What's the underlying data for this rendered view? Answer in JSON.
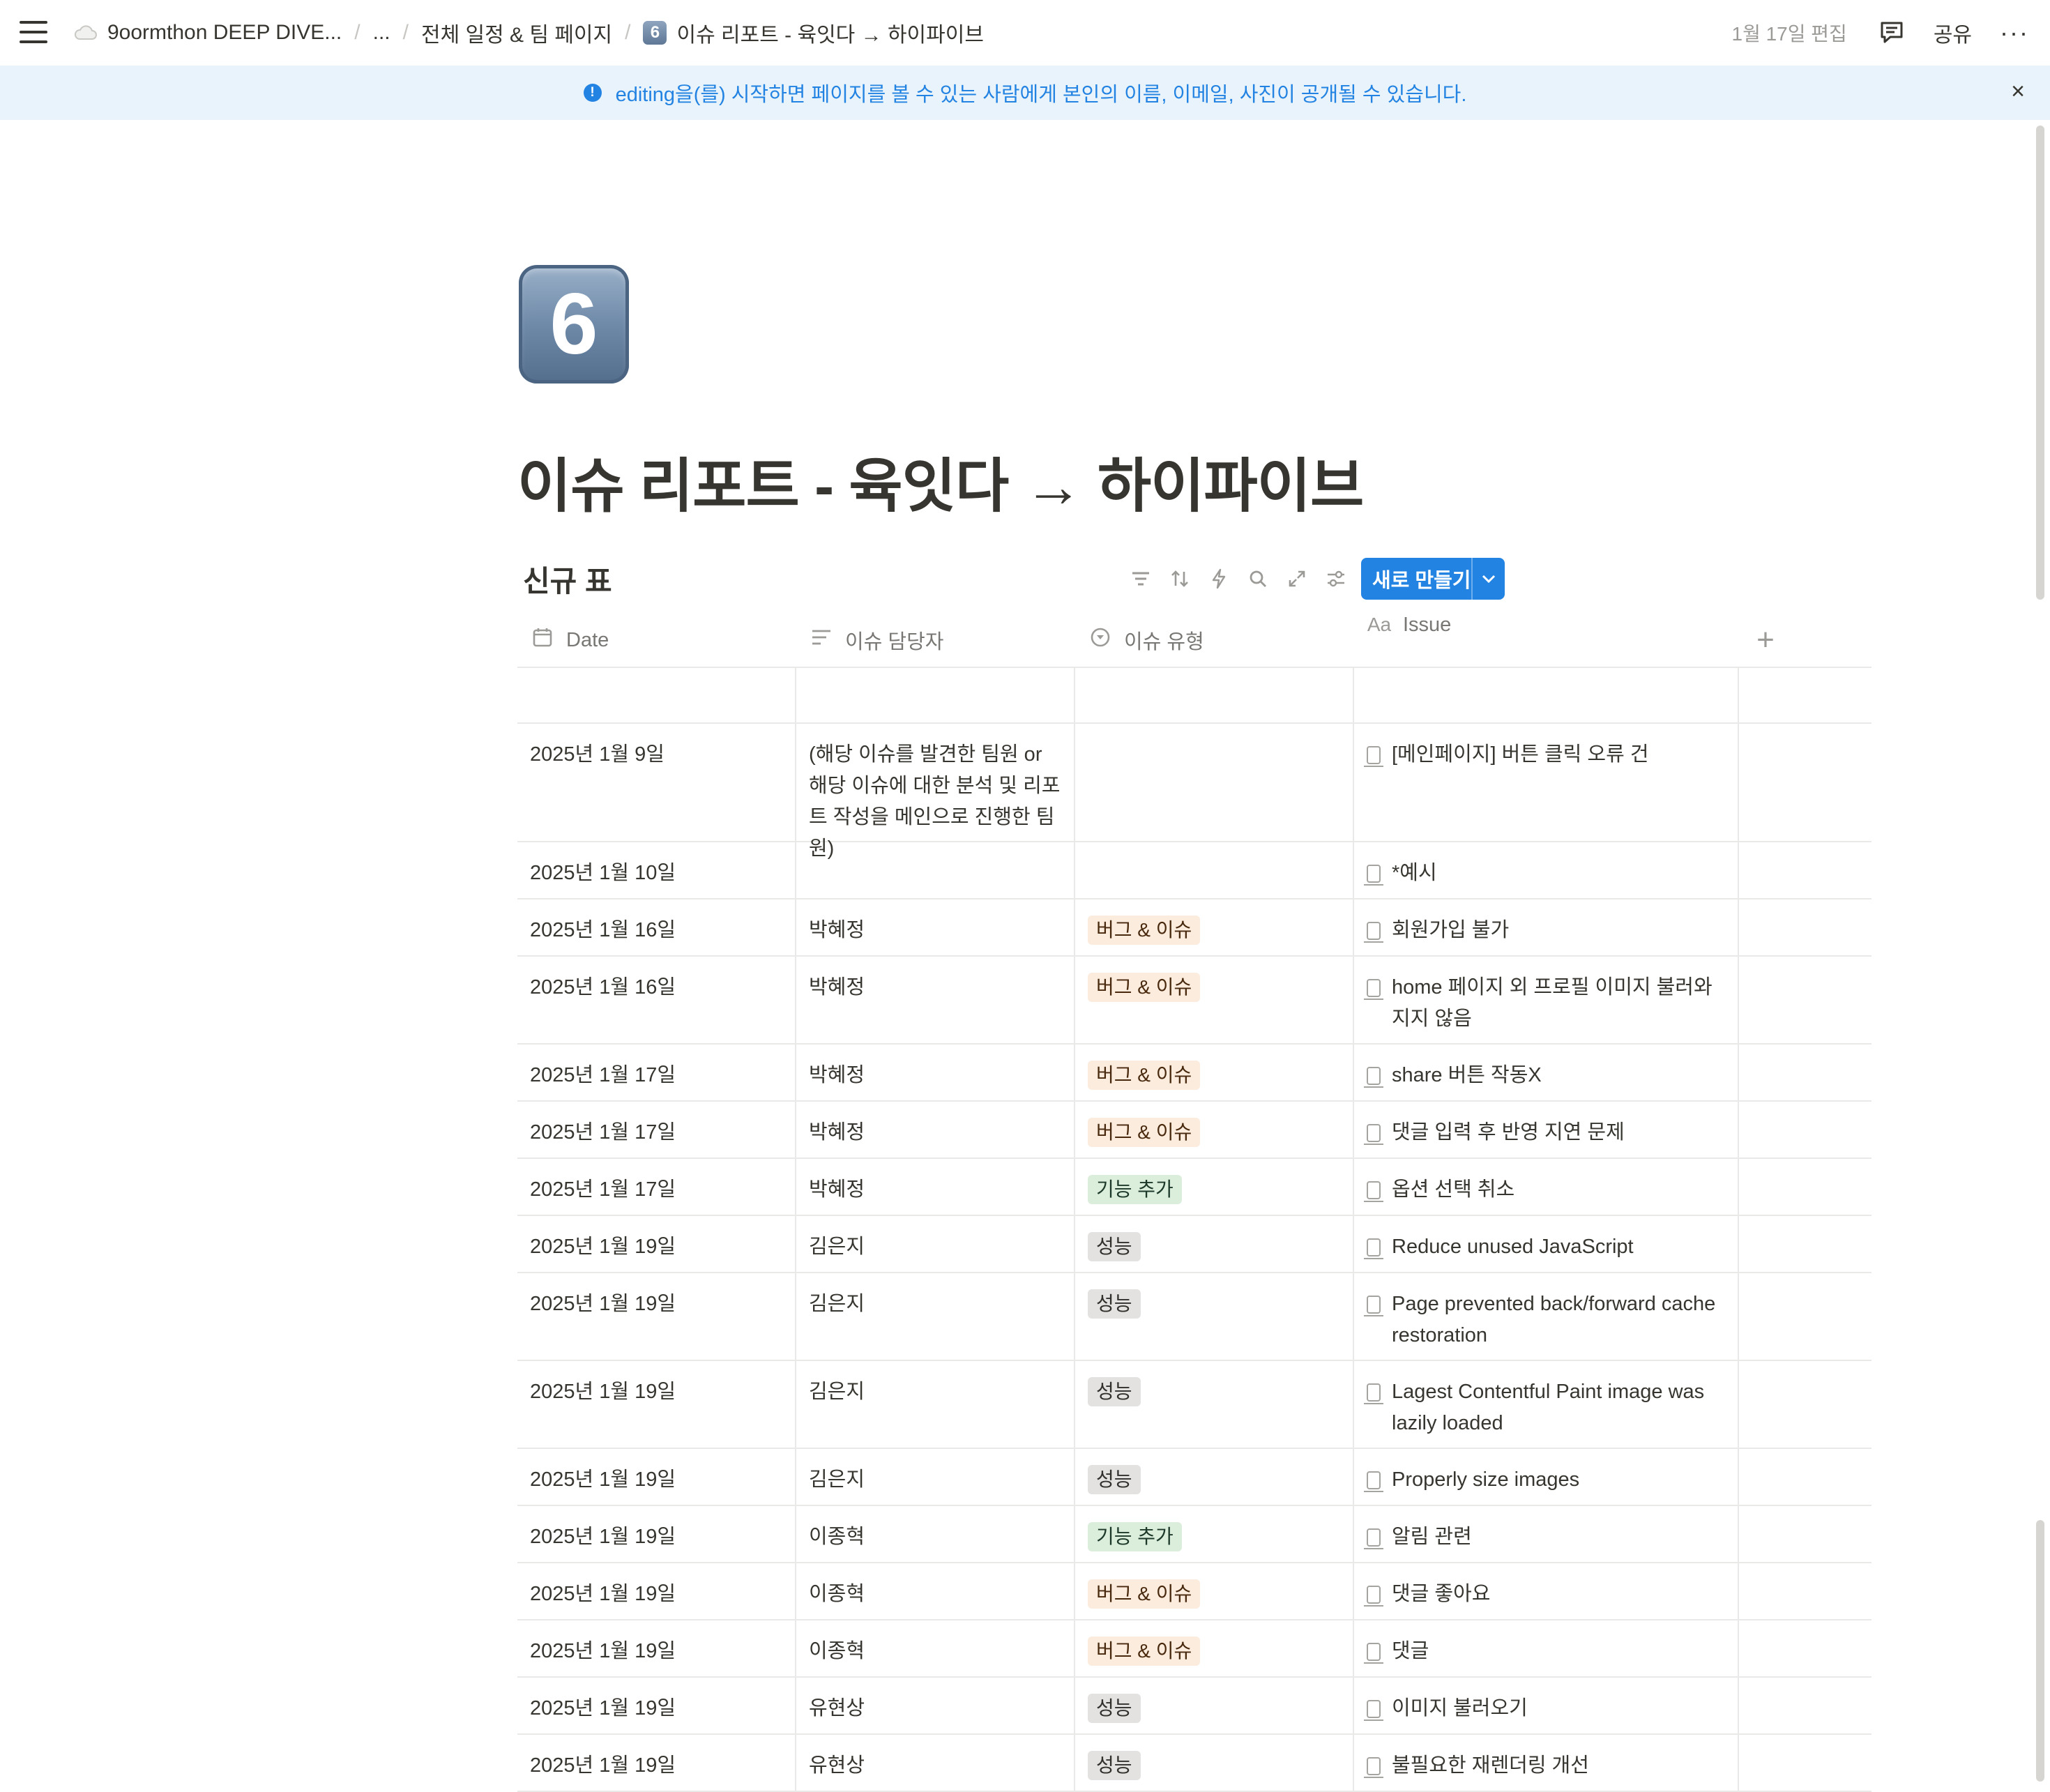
{
  "topbar": {
    "breadcrumbs": [
      "9oormthon DEEP DIVE...",
      "...",
      "전체 일정 & 팀 페이지",
      "이슈 리포트 - 육잇다 → 하이파이브"
    ],
    "page_emoji": "6",
    "edited": "1월 17일 편집",
    "share_label": "공유",
    "more_label": "···"
  },
  "banner": {
    "message": "editing을(를) 시작하면 페이지를 볼 수 있는 사람에게 본인의 이름, 이메일, 사진이 공개될 수 있습니다.",
    "close": "×"
  },
  "page": {
    "icon_text": "6",
    "title": "이슈 리포트 - 육잇다 → 하이파이브"
  },
  "database": {
    "title": "신규 표",
    "new_button": "새로 만들기",
    "columns": [
      {
        "label": "Date",
        "icon": "calendar-icon"
      },
      {
        "label": "이슈 담당자",
        "icon": "text-lines-icon"
      },
      {
        "label": "이슈 유형",
        "icon": "select-icon"
      },
      {
        "label": "Issue",
        "icon": "title-aa-icon"
      }
    ],
    "rows": [
      {
        "date": "",
        "owner": "",
        "type": "",
        "type_kind": "",
        "issue": ""
      },
      {
        "date": "2025년 1월 9일",
        "owner": "(해당 이슈를 발견한 팀원 or 해당 이슈에 대한 분석 및 리포트 작성을 메인으로 진행한 팀원)",
        "type": "",
        "type_kind": "",
        "issue": "[메인페이지] 버튼 클릭 오류 건"
      },
      {
        "date": "2025년 1월 10일",
        "owner": "",
        "type": "",
        "type_kind": "",
        "issue": "*예시"
      },
      {
        "date": "2025년 1월 16일",
        "owner": "박혜정",
        "type": "버그 & 이슈",
        "type_kind": "bug",
        "issue": "회원가입 불가"
      },
      {
        "date": "2025년 1월 16일",
        "owner": "박혜정",
        "type": "버그 & 이슈",
        "type_kind": "bug",
        "issue": "home 페이지 외 프로필 이미지 불러와지지 않음"
      },
      {
        "date": "2025년 1월 17일",
        "owner": "박혜정",
        "type": "버그 & 이슈",
        "type_kind": "bug",
        "issue": "share 버튼 작동X"
      },
      {
        "date": "2025년 1월 17일",
        "owner": "박혜정",
        "type": "버그 & 이슈",
        "type_kind": "bug",
        "issue": "댓글 입력 후 반영 지연 문제"
      },
      {
        "date": "2025년 1월 17일",
        "owner": "박혜정",
        "type": "기능 추가",
        "type_kind": "feature",
        "issue": "옵션 선택 취소"
      },
      {
        "date": "2025년 1월 19일",
        "owner": "김은지",
        "type": "성능",
        "type_kind": "perf",
        "issue": "Reduce unused JavaScript"
      },
      {
        "date": "2025년 1월 19일",
        "owner": "김은지",
        "type": "성능",
        "type_kind": "perf",
        "issue": "Page prevented back/forward cache restoration"
      },
      {
        "date": "2025년 1월 19일",
        "owner": "김은지",
        "type": "성능",
        "type_kind": "perf",
        "issue": "Lagest Contentful Paint image was lazily loaded"
      },
      {
        "date": "2025년 1월 19일",
        "owner": "김은지",
        "type": "성능",
        "type_kind": "perf",
        "issue": "Properly size images"
      },
      {
        "date": "2025년 1월 19일",
        "owner": "이종혁",
        "type": "기능 추가",
        "type_kind": "feature",
        "issue": "알림 관련"
      },
      {
        "date": "2025년 1월 19일",
        "owner": "이종혁",
        "type": "버그 & 이슈",
        "type_kind": "bug",
        "issue": "댓글 좋아요"
      },
      {
        "date": "2025년 1월 19일",
        "owner": "이종혁",
        "type": "버그 & 이슈",
        "type_kind": "bug",
        "issue": "댓글"
      },
      {
        "date": "2025년 1월 19일",
        "owner": "유현상",
        "type": "성능",
        "type_kind": "perf",
        "issue": "이미지 불러오기"
      },
      {
        "date": "2025년 1월 19일",
        "owner": "유현상",
        "type": "성능",
        "type_kind": "perf",
        "issue": "불필요한 재렌더링 개선"
      }
    ]
  },
  "colors": {
    "accent": "#2383e2",
    "banner_bg": "#e9f3fb",
    "tag_bug_bg": "#fbecdd",
    "tag_feature_bg": "#dbeddb",
    "tag_perf_bg": "#e3e2e0"
  }
}
